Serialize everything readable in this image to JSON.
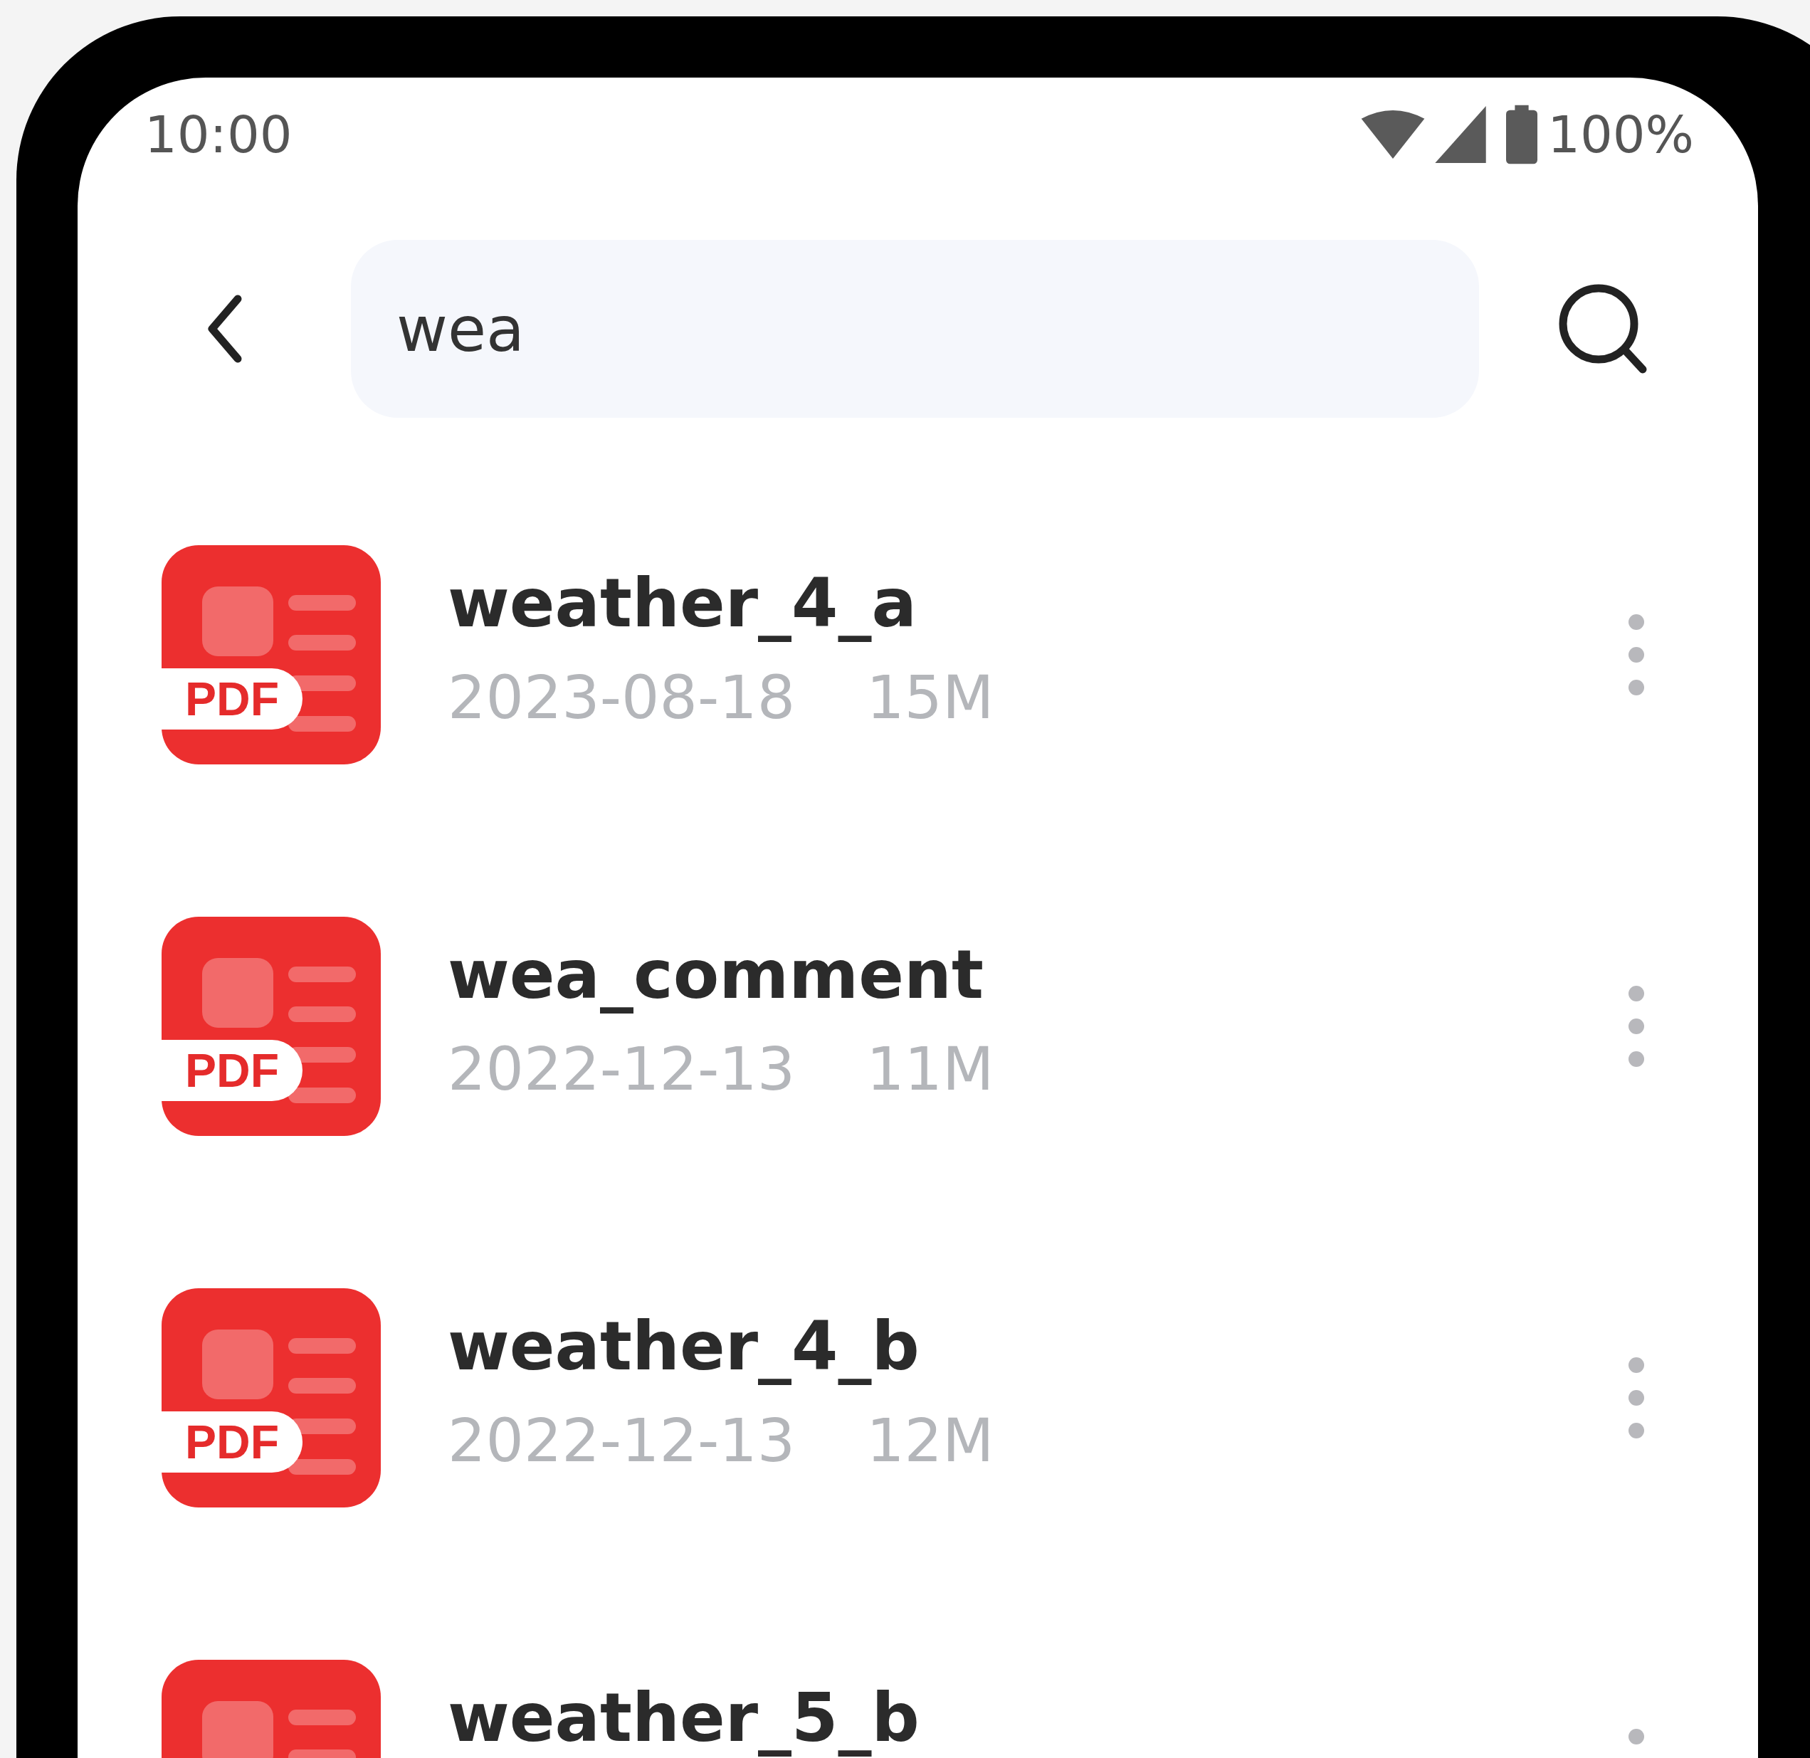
{
  "status_bar": {
    "time": "10:00",
    "battery": "100%"
  },
  "search": {
    "value": "wea"
  },
  "files": [
    {
      "name": "weather_4_a",
      "badge": "PDF",
      "date": "2023-08-18",
      "size": "15M"
    },
    {
      "name": "wea_comment",
      "badge": "PDF",
      "date": "2022-12-13",
      "size": "11M"
    },
    {
      "name": "weather_4_b",
      "badge": "PDF",
      "date": "2022-12-13",
      "size": "12M"
    },
    {
      "name": "weather_5_b"
    }
  ]
}
